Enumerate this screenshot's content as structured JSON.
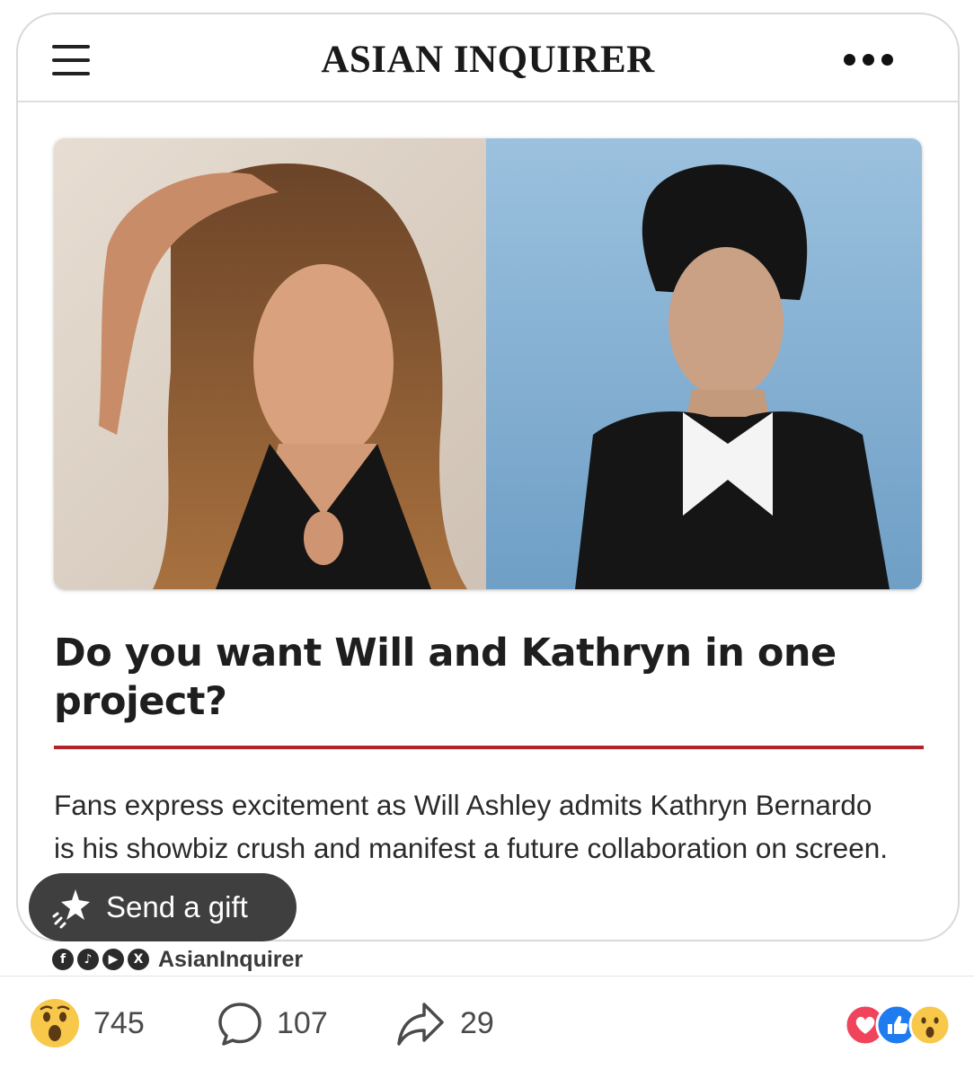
{
  "header": {
    "brand": "ASIAN INQUIRER",
    "menu_icon": "hamburger-menu-icon",
    "more_icon": "more-dots-icon"
  },
  "article": {
    "image_icon": "photo-collage",
    "headline": "Do you want Will and Kathryn in one project?",
    "summary": "Fans express excitement as Will Ashley admits Kathryn Bernardo is his showbiz crush and manifest a future collaboration on screen.",
    "accent_color": "#b3232b"
  },
  "gift_button": {
    "label": "Send a gift",
    "icon": "gift-sparkle-icon"
  },
  "social": {
    "icons": [
      "facebook-icon",
      "tiktok-icon",
      "youtube-icon",
      "x-icon"
    ],
    "handle": "AsianInquirer"
  },
  "actions": {
    "reaction_count": "745",
    "comment_count": "107",
    "share_count": "29",
    "reaction_icon": "wow-emoji-icon",
    "comment_icon": "comment-bubble-icon",
    "share_icon": "share-arrow-icon",
    "reaction_summary_icons": [
      "love-icon",
      "like-icon",
      "wow-icon"
    ]
  }
}
